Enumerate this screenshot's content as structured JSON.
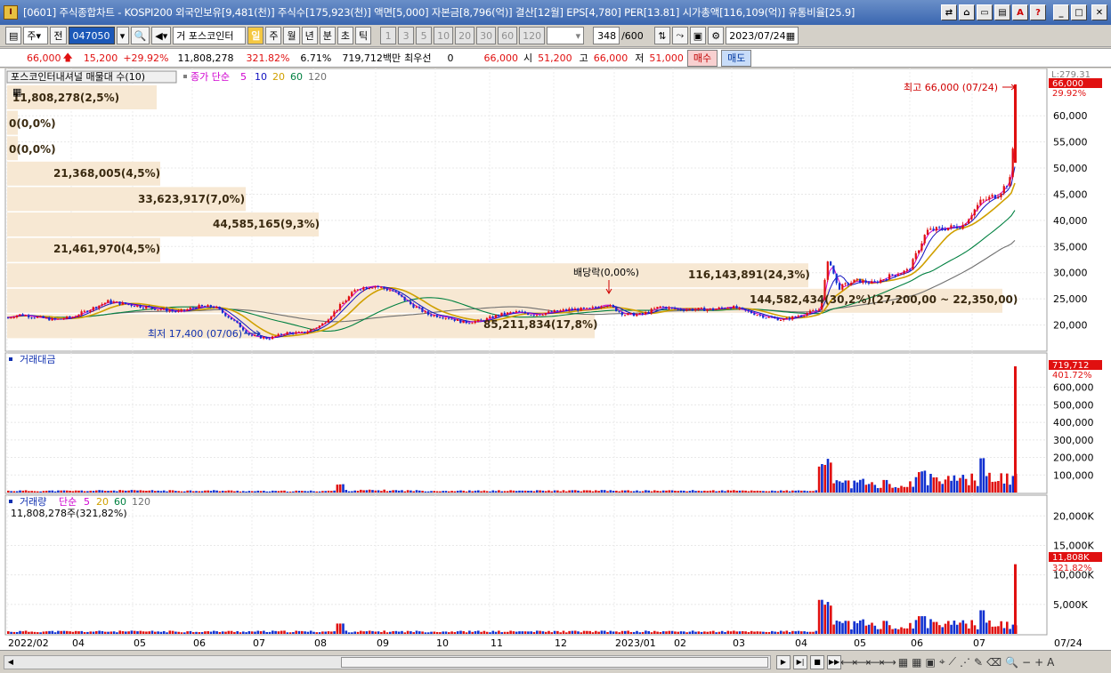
{
  "window": {
    "title": "[0601] 주식종합차트 - KOSPI200 외국인보유[9,481(천)] 주식수[175,923(천)] 액면[5,000] 자본금[8,796(억)] 결산[12월] EPS[4,780] PER[13.81] 시가총액[116,109(억)] 유통비율[25.9]"
  },
  "toolbar": {
    "market": "주",
    "prev": "전",
    "code": "047050",
    "name": "포스코인터",
    "name_prefix": "거",
    "periods": [
      "일",
      "주",
      "월",
      "년",
      "분",
      "초",
      "틱"
    ],
    "active_period": "일",
    "intervals": [
      "1",
      "3",
      "5",
      "10",
      "20",
      "30",
      "60",
      "120"
    ],
    "count": "348",
    "count_total": "/600",
    "date": "2023/07/24"
  },
  "quote": {
    "price": "66,000",
    "change": "15,200",
    "change_pct": "+29.92%",
    "volume": "11,808,278",
    "volume_pct": "321.82%",
    "turnover": "6.71%",
    "amount": "719,712백만",
    "pref_label": "최우선",
    "pref_value": "0",
    "ask": "66,000",
    "open_label": "시",
    "open": "51,200",
    "high_label": "고",
    "high": "66,000",
    "low_label": "저",
    "low": "51,000",
    "buy": "매수",
    "sell": "매도"
  },
  "price_panel": {
    "indicator_label": "포스코인터내셔널 매물대 수(10)",
    "ma_label": "종가 단순",
    "ma": [
      "5",
      "10",
      "20",
      "60",
      "120"
    ],
    "ma_colors": [
      "#d000d0",
      "#1010c0",
      "#d0a000",
      "#008040",
      "#707070"
    ],
    "volume_profile": [
      "11,808,278(2,5%)",
      "0(0,0%)",
      "0(0,0%)",
      "21,368,005(4,5%)",
      "33,623,917(7,0%)",
      "44,585,165(9,3%)",
      "21,461,970(4,5%)",
      "116,143,891(24,3%)",
      "144,582,434(30,2%)(27,200,00 ~ 22,350,00)",
      "85,211,834(17,8%)"
    ],
    "high_note": "최고 66,000 (07/24)",
    "low_note": "최저 17,400 (07/06)",
    "dividend_note": "배당락(0,00%)",
    "y_top_label": "L:279.31",
    "last_price": "66,000",
    "last_pct": "29.92%",
    "y_ticks": [
      "60,000",
      "55,000",
      "50,000",
      "45,000",
      "40,000",
      "35,000",
      "30,000",
      "25,000",
      "20,000"
    ]
  },
  "amount_panel": {
    "label": "거래대금",
    "last": "719,712",
    "last_pct": "401.72%",
    "y_ticks": [
      "600,000",
      "500,000",
      "400,000",
      "300,000",
      "200,000",
      "100,000"
    ]
  },
  "volume_panel": {
    "label": "거래량",
    "ma_label": "단순",
    "ma": [
      "5",
      "20",
      "60",
      "120"
    ],
    "ma_colors": [
      "#d000d0",
      "#d0a000",
      "#008040",
      "#707070"
    ],
    "last_line": "11,808,278주(321,82%)",
    "last": "11,808K",
    "last_pct": "321.82%",
    "y_ticks": [
      "20,000K",
      "15,000K",
      "10,000K",
      "5,000K"
    ]
  },
  "x_axis": {
    "labels": [
      "2022/02",
      "04",
      "05",
      "06",
      "07",
      "08",
      "09",
      "10",
      "11",
      "12",
      "2023/01",
      "02",
      "03",
      "04",
      "05",
      "06",
      "07"
    ],
    "right_label": "07/24"
  },
  "chart_data": {
    "type": "candlestick",
    "price_series": [
      [
        0,
        21000
      ],
      [
        20,
        22000
      ],
      [
        40,
        21500
      ],
      [
        60,
        21000
      ],
      [
        80,
        21500
      ],
      [
        100,
        23000
      ],
      [
        120,
        24500
      ],
      [
        140,
        24000
      ],
      [
        160,
        23500
      ],
      [
        180,
        23000
      ],
      [
        200,
        22500
      ],
      [
        220,
        23500
      ],
      [
        240,
        23500
      ],
      [
        260,
        21000
      ],
      [
        280,
        18000
      ],
      [
        300,
        17400
      ],
      [
        320,
        18500
      ],
      [
        340,
        18500
      ],
      [
        360,
        20000
      ],
      [
        380,
        23500
      ],
      [
        400,
        27000
      ],
      [
        420,
        27500
      ],
      [
        440,
        26500
      ],
      [
        460,
        24000
      ],
      [
        480,
        22000
      ],
      [
        500,
        21500
      ],
      [
        520,
        20500
      ],
      [
        540,
        20800
      ],
      [
        560,
        22000
      ],
      [
        580,
        22500
      ],
      [
        600,
        22000
      ],
      [
        620,
        22500
      ],
      [
        640,
        23000
      ],
      [
        660,
        23000
      ],
      [
        680,
        24000
      ],
      [
        700,
        22000
      ],
      [
        720,
        22000
      ],
      [
        740,
        23500
      ],
      [
        760,
        23000
      ],
      [
        780,
        23000
      ],
      [
        800,
        23000
      ],
      [
        820,
        23500
      ],
      [
        840,
        22500
      ],
      [
        860,
        21500
      ],
      [
        880,
        21000
      ],
      [
        900,
        22000
      ],
      [
        920,
        23000
      ],
      [
        930,
        33000
      ],
      [
        940,
        27000
      ],
      [
        960,
        28500
      ],
      [
        980,
        28000
      ],
      [
        1000,
        29500
      ],
      [
        1020,
        30500
      ],
      [
        1040,
        38000
      ],
      [
        1060,
        38500
      ],
      [
        1080,
        39000
      ],
      [
        1100,
        43500
      ],
      [
        1120,
        45000
      ],
      [
        1135,
        48000
      ],
      [
        1140,
        66000
      ]
    ],
    "x_labels": [
      "2022/02",
      "04",
      "05",
      "06",
      "07",
      "08",
      "09",
      "10",
      "11",
      "12",
      "2023/01",
      "02",
      "03",
      "04",
      "05",
      "06",
      "07"
    ],
    "price_ylim": [
      15000,
      67000
    ],
    "amount_ylim": [
      0,
      720000
    ],
    "volume_ylim": [
      0,
      22000000
    ],
    "high": 66000,
    "low": 17400
  }
}
